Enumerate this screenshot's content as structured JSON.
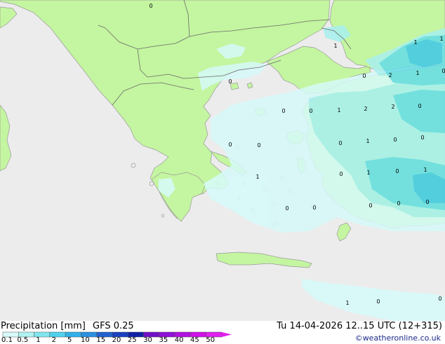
{
  "map": {
    "sea_color": "#ececec",
    "land_color": "#c4f5a0",
    "precip_levels": [
      "0.1",
      "0.5",
      "1",
      "2"
    ],
    "level_colors": [
      "#d6fafa",
      "#a8f0f0",
      "#66dde8",
      "#40c8e8"
    ],
    "point_values": [
      "0",
      "1",
      "2",
      "1",
      "0",
      "1",
      "1",
      "0",
      "0",
      "0",
      "0",
      "1",
      "2",
      "2",
      "0",
      "0",
      "0",
      "0",
      "1",
      "0",
      "0",
      "1",
      "0",
      "1",
      "0",
      "1",
      "0",
      "0",
      "0",
      "0",
      "0",
      "1",
      "0",
      "0"
    ]
  },
  "footer": {
    "title": "Precipitation [mm]",
    "model": "GFS 0.25",
    "datetime": "Tu 14-04-2026 12..15 UTC (12+315)",
    "credit": "©weatheronline.co.uk"
  },
  "legend": {
    "values": [
      "0.1",
      "0.5",
      "1",
      "2",
      "5",
      "10",
      "15",
      "20",
      "25",
      "30",
      "35",
      "40",
      "45",
      "50"
    ],
    "colors": [
      "#d8fafa",
      "#b0f2f2",
      "#80e6ee",
      "#50d2ee",
      "#30b0e8",
      "#2a90e0",
      "#2060d0",
      "#1840c0",
      "#1020a8",
      "#7010c8",
      "#9010d8",
      "#b010e0",
      "#d010e8",
      "#e020f0"
    ]
  }
}
